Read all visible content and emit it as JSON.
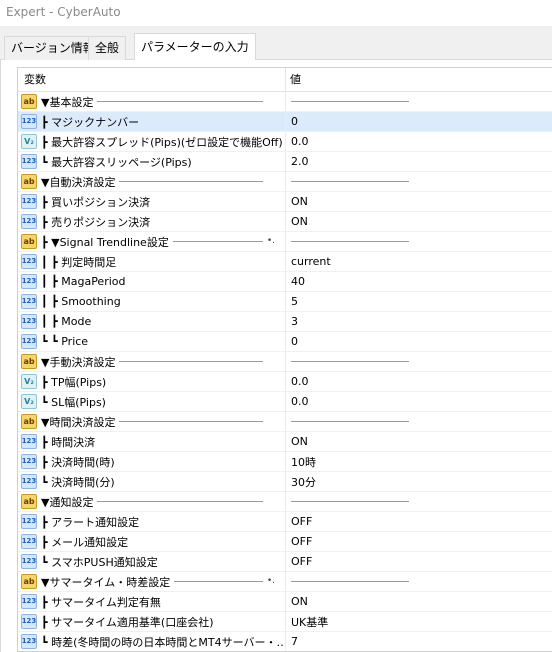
{
  "window": {
    "title": "Expert - CyberAuto"
  },
  "tabs": [
    {
      "label": "バージョン情報"
    },
    {
      "label": "全般"
    },
    {
      "label": "パラメーターの入力"
    }
  ],
  "table": {
    "headers": {
      "variable": "変数",
      "value": "値"
    },
    "rows": [
      {
        "icon": "ab",
        "label": "▼基本設定",
        "value": "",
        "group": true
      },
      {
        "icon": "123",
        "label": "┣ マジックナンバー",
        "value": "0",
        "selected": true
      },
      {
        "icon": "v2",
        "label": "┣ 最大許容スプレッド(Pips)(ゼロ設定で機能Off)",
        "value": "0.0"
      },
      {
        "icon": "123",
        "label": "┗ 最大許容スリッページ(Pips)",
        "value": "2.0"
      },
      {
        "icon": "ab",
        "label": "▼自動決済設定",
        "value": "",
        "group": true
      },
      {
        "icon": "123",
        "label": "┣ 買いポジション決済",
        "value": "ON"
      },
      {
        "icon": "123",
        "label": "┣ 売りポジション決済",
        "value": "ON"
      },
      {
        "icon": "ab",
        "label": "┣ ▼Signal Trendline設定",
        "value": "",
        "group": true,
        "dots": true
      },
      {
        "icon": "123",
        "label": "┃ ┣ 判定時間足",
        "value": "current"
      },
      {
        "icon": "123",
        "label": "┃ ┣ MagaPeriod",
        "value": "40"
      },
      {
        "icon": "123",
        "label": "┃ ┣ Smoothing",
        "value": "5"
      },
      {
        "icon": "123",
        "label": "┃ ┣ Mode",
        "value": "3"
      },
      {
        "icon": "123",
        "label": "┗ ┗ Price",
        "value": "0"
      },
      {
        "icon": "ab",
        "label": "▼手動決済設定",
        "value": "",
        "group": true
      },
      {
        "icon": "v2",
        "label": "┣ TP幅(Pips)",
        "value": "0.0"
      },
      {
        "icon": "v2",
        "label": "┗ SL幅(Pips)",
        "value": "0.0"
      },
      {
        "icon": "ab",
        "label": "▼時間決済設定",
        "value": "",
        "group": true
      },
      {
        "icon": "123",
        "label": "┣ 時間決済",
        "value": "ON"
      },
      {
        "icon": "123",
        "label": "┣ 決済時間(時)",
        "value": "10時"
      },
      {
        "icon": "123",
        "label": "┗ 決済時間(分)",
        "value": "30分"
      },
      {
        "icon": "ab",
        "label": "▼通知設定",
        "value": "",
        "group": true
      },
      {
        "icon": "123",
        "label": "┣ アラート通知設定",
        "value": "OFF"
      },
      {
        "icon": "123",
        "label": "┣ メール通知設定",
        "value": "OFF"
      },
      {
        "icon": "123",
        "label": "┗ スマホPUSH通知設定",
        "value": "OFF"
      },
      {
        "icon": "ab",
        "label": "▼サマータイム・時差設定",
        "value": "",
        "group": true,
        "dots": true
      },
      {
        "icon": "123",
        "label": "┣ サマータイム判定有無",
        "value": "ON"
      },
      {
        "icon": "123",
        "label": "┣ サマータイム適用基準(口座会社)",
        "value": "UK基準"
      },
      {
        "icon": "123",
        "label": "┗ 時差(冬時間の時の日本時間とMT4サーバー・…",
        "value": "7"
      }
    ]
  }
}
